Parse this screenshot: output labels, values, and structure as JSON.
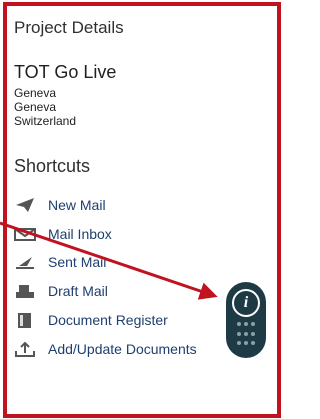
{
  "project_details": {
    "heading": "Project Details",
    "name": "TOT Go Live",
    "address": [
      "Geneva",
      "Geneva",
      "Switzerland"
    ]
  },
  "shortcuts": {
    "heading": "Shortcuts",
    "items": [
      {
        "label": "New Mail",
        "icon": "send-icon"
      },
      {
        "label": "Mail Inbox",
        "icon": "inbox-icon"
      },
      {
        "label": "Sent Mail",
        "icon": "sent-icon"
      },
      {
        "label": "Draft Mail",
        "icon": "draft-icon"
      },
      {
        "label": "Document Register",
        "icon": "document-icon"
      },
      {
        "label": "Add/Update Documents",
        "icon": "upload-icon"
      }
    ]
  },
  "colors": {
    "accent_border": "#c1121f",
    "fab_bg": "#1e3b45",
    "link": "#1f3f6f"
  }
}
